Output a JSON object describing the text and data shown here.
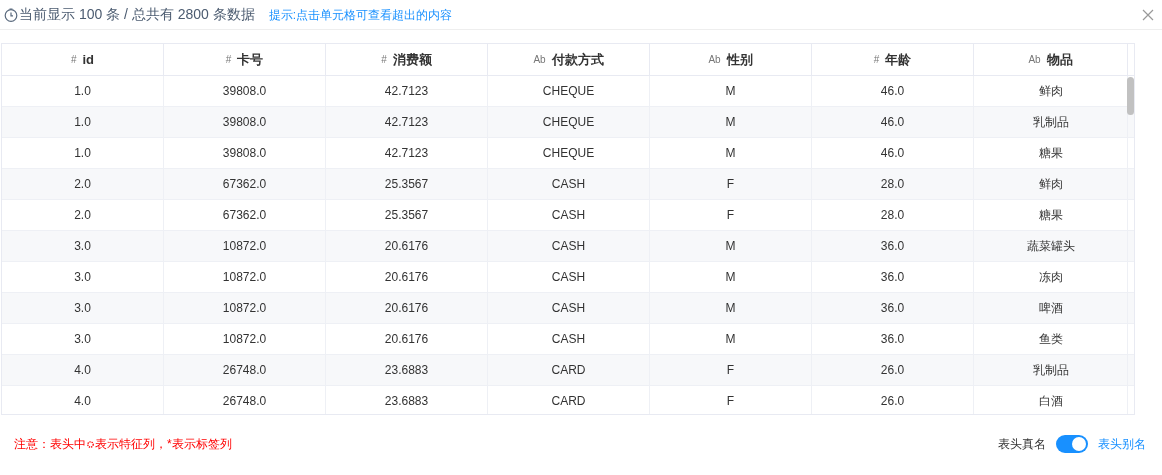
{
  "header": {
    "summary": "当前显示 100 条 / 总共有 2800 条数据",
    "hint": "提示:点击单元格可查看超出的内容"
  },
  "table": {
    "columns": [
      {
        "type_label": "#",
        "label": "id"
      },
      {
        "type_label": "#",
        "label": "卡号"
      },
      {
        "type_label": "#",
        "label": "消费额"
      },
      {
        "type_label": "Ab",
        "label": "付款方式"
      },
      {
        "type_label": "Ab",
        "label": "性别"
      },
      {
        "type_label": "#",
        "label": "年龄"
      },
      {
        "type_label": "Ab",
        "label": "物品"
      }
    ],
    "rows": [
      [
        "1.0",
        "39808.0",
        "42.7123",
        "CHEQUE",
        "M",
        "46.0",
        "鲜肉"
      ],
      [
        "1.0",
        "39808.0",
        "42.7123",
        "CHEQUE",
        "M",
        "46.0",
        "乳制品"
      ],
      [
        "1.0",
        "39808.0",
        "42.7123",
        "CHEQUE",
        "M",
        "46.0",
        "糖果"
      ],
      [
        "2.0",
        "67362.0",
        "25.3567",
        "CASH",
        "F",
        "28.0",
        "鲜肉"
      ],
      [
        "2.0",
        "67362.0",
        "25.3567",
        "CASH",
        "F",
        "28.0",
        "糖果"
      ],
      [
        "3.0",
        "10872.0",
        "20.6176",
        "CASH",
        "M",
        "36.0",
        "蔬菜罐头"
      ],
      [
        "3.0",
        "10872.0",
        "20.6176",
        "CASH",
        "M",
        "36.0",
        "冻肉"
      ],
      [
        "3.0",
        "10872.0",
        "20.6176",
        "CASH",
        "M",
        "36.0",
        "啤酒"
      ],
      [
        "3.0",
        "10872.0",
        "20.6176",
        "CASH",
        "M",
        "36.0",
        "鱼类"
      ],
      [
        "4.0",
        "26748.0",
        "23.6883",
        "CARD",
        "F",
        "26.0",
        "乳制品"
      ],
      [
        "4.0",
        "26748.0",
        "23.6883",
        "CARD",
        "F",
        "26.0",
        "白酒"
      ]
    ]
  },
  "footer": {
    "note_before": "注意：表头中",
    "note_after": "表示特征列，*表示标签列",
    "toggle_left": "表头真名",
    "toggle_right": "表头别名",
    "toggle_on": true
  }
}
